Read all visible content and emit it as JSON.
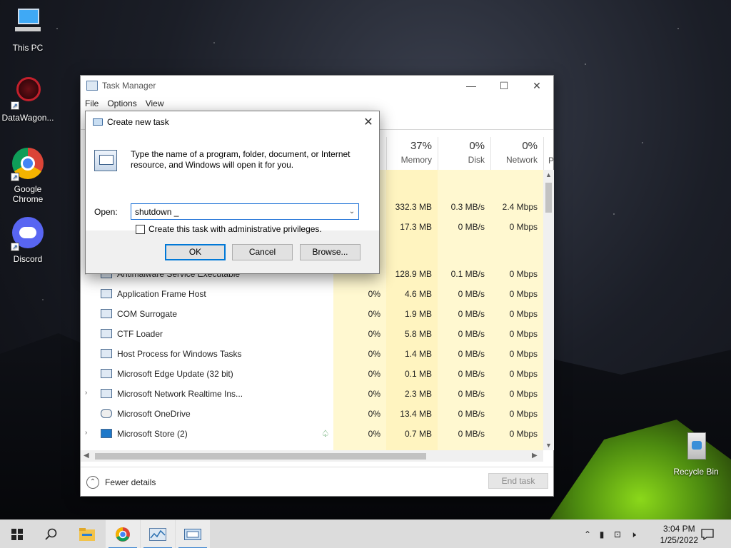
{
  "desktop": {
    "icons": [
      {
        "label": "This PC"
      },
      {
        "label": "DataWagon..."
      },
      {
        "label": "Google\nChrome"
      },
      {
        "label": "Discord"
      },
      {
        "label": "Recycle Bin"
      }
    ]
  },
  "task_manager": {
    "title": "Task Manager",
    "menu": [
      "File",
      "Options",
      "View"
    ],
    "columns": [
      {
        "percent": "37%",
        "name": "Memory"
      },
      {
        "percent": "0%",
        "name": "Disk"
      },
      {
        "percent": "0%",
        "name": "Network"
      }
    ],
    "partial_column_header": "P",
    "rows": [
      {
        "name": "",
        "cpu": "",
        "memory": "332.3 MB",
        "disk": "0.3 MB/s",
        "network": "2.4 Mbps"
      },
      {
        "name": "",
        "cpu": "",
        "memory": "17.3 MB",
        "disk": "0 MB/s",
        "network": "0 Mbps"
      },
      {
        "name": "Antimalware Service Executable",
        "cpu": "",
        "memory": "128.9 MB",
        "disk": "0.1 MB/s",
        "network": "0 Mbps"
      },
      {
        "name": "Application Frame Host",
        "cpu": "0%",
        "memory": "4.6 MB",
        "disk": "0 MB/s",
        "network": "0 Mbps"
      },
      {
        "name": "COM Surrogate",
        "cpu": "0%",
        "memory": "1.9 MB",
        "disk": "0 MB/s",
        "network": "0 Mbps"
      },
      {
        "name": "CTF Loader",
        "cpu": "0%",
        "memory": "5.8 MB",
        "disk": "0 MB/s",
        "network": "0 Mbps"
      },
      {
        "name": "Host Process for Windows Tasks",
        "cpu": "0%",
        "memory": "1.4 MB",
        "disk": "0 MB/s",
        "network": "0 Mbps"
      },
      {
        "name": "Microsoft Edge Update (32 bit)",
        "cpu": "0%",
        "memory": "0.1 MB",
        "disk": "0 MB/s",
        "network": "0 Mbps"
      },
      {
        "name": "Microsoft Network Realtime Ins...",
        "cpu": "0%",
        "memory": "2.3 MB",
        "disk": "0 MB/s",
        "network": "0 Mbps"
      },
      {
        "name": "Microsoft OneDrive",
        "cpu": "0%",
        "memory": "13.4 MB",
        "disk": "0 MB/s",
        "network": "0 Mbps"
      },
      {
        "name": "Microsoft Store (2)",
        "cpu": "0%",
        "memory": "0.7 MB",
        "disk": "0 MB/s",
        "network": "0 Mbps"
      }
    ],
    "fewer_details": "Fewer details",
    "end_task": "End task"
  },
  "run_dialog": {
    "title": "Create new task",
    "description": "Type the name of a program, folder, document, or Internet resource, and Windows will open it for you.",
    "open_label": "Open:",
    "open_value": "shutdown _",
    "admin_checkbox_label": "Create this task with administrative privileges.",
    "ok": "OK",
    "cancel": "Cancel",
    "browse": "Browse..."
  },
  "taskbar": {
    "time": "3:04 PM",
    "date": "1/25/2022"
  }
}
